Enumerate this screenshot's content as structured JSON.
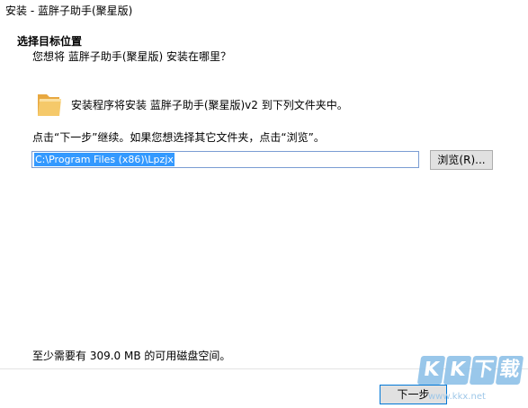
{
  "window": {
    "title": "安装 - 蓝胖子助手(聚星版)"
  },
  "header": {
    "title": "选择目标位置",
    "subtitle": "您想将 蓝胖子助手(聚星版)   安装在哪里？"
  },
  "main": {
    "folder_text": "安装程序将安装 蓝胖子助手(聚星版)v2 到下列文件夹中。",
    "continue_text": "点击“下一步”继续。如果您想选择其它文件夹，点击“浏览”。",
    "path_value": "C:\\Program Files (x86)\\Lpzjx",
    "browse_label": "浏览(R)...",
    "space_text": "至少需要有 309.0 MB 的可用磁盘空间。"
  },
  "footer": {
    "next_label": "下一步"
  },
  "watermark": {
    "chars": [
      "K",
      "K",
      "下",
      "载"
    ],
    "url": "www.kkx.net"
  },
  "colors": {
    "selection": "#3399ff",
    "button_bg": "#e1e1e1",
    "folder": "#f0c060",
    "watermark": "#8fc1e8"
  },
  "icons": {
    "folder": "folder-icon"
  }
}
